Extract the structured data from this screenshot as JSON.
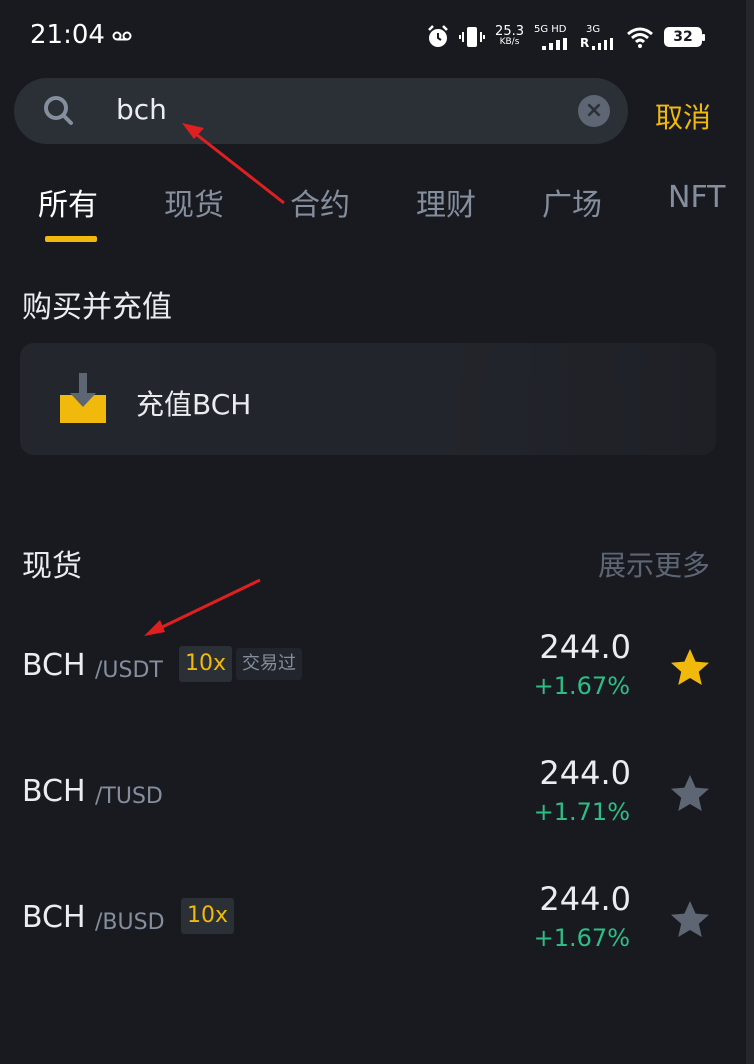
{
  "status_bar": {
    "time": "21:04",
    "net_speed": "25.3",
    "net_unit": "KB/s",
    "sig1": "5G HD",
    "sig2": "3G",
    "sig2_sub": "R",
    "battery": "32"
  },
  "search": {
    "query": "bch",
    "cancel_label": "取消"
  },
  "tabs": [
    {
      "label": "所有",
      "active": true
    },
    {
      "label": "现货",
      "active": false
    },
    {
      "label": "合约",
      "active": false
    },
    {
      "label": "理财",
      "active": false
    },
    {
      "label": "广场",
      "active": false
    },
    {
      "label": "NFT",
      "active": false
    }
  ],
  "buy_section": {
    "title": "购买并充值",
    "deposit_label": "充值BCH"
  },
  "spot_section": {
    "title": "现货",
    "show_more": "展示更多",
    "pairs": [
      {
        "base": "BCH",
        "quote": "/USDT",
        "leverage": "10x",
        "traded": "交易过",
        "price": "244.0",
        "change": "+1.67%",
        "favorited": true
      },
      {
        "base": "BCH",
        "quote": "/TUSD",
        "leverage": "",
        "traded": "",
        "price": "244.0",
        "change": "+1.71%",
        "favorited": false
      },
      {
        "base": "BCH",
        "quote": "/BUSD",
        "leverage": "10x",
        "traded": "",
        "price": "244.0",
        "change": "+1.67%",
        "favorited": false
      }
    ]
  },
  "colors": {
    "background": "#181a20",
    "accent": "#f0b90b",
    "positive": "#2ebd85",
    "muted": "#848e9c",
    "annotation": "#e02020"
  }
}
